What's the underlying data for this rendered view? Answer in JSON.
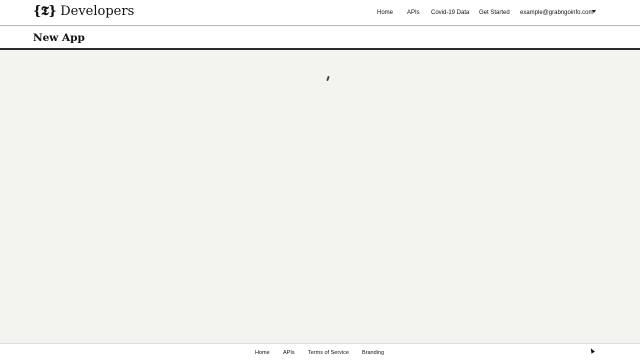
{
  "header": {
    "logo_glyph": "{𝕿}",
    "brand": "Developers",
    "nav": [
      {
        "label": "Home"
      },
      {
        "label": "APIs"
      },
      {
        "label": "Covid-19 Data"
      },
      {
        "label": "Get Started"
      }
    ],
    "account_email": "example@grabngoinfo.com"
  },
  "page": {
    "title": "New App"
  },
  "footer": {
    "links": [
      {
        "label": "Home"
      },
      {
        "label": "APIs"
      },
      {
        "label": "Terms of Service"
      },
      {
        "label": "Branding"
      }
    ]
  },
  "icons": {
    "account_menu": "chevron-down-icon",
    "loading": "loading-spinner-icon",
    "pointer": "mouse-cursor-icon"
  }
}
